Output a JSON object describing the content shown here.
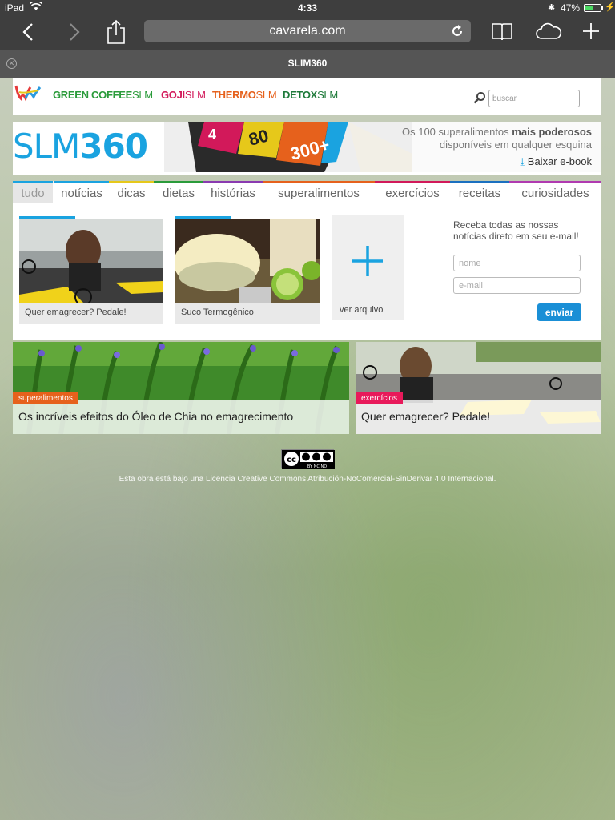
{
  "status": {
    "carrier": "iPad",
    "time": "4:33",
    "battery": "47%",
    "battery_level": 0.47
  },
  "browser": {
    "url": "cavarela.com",
    "tab_title": "SLIM360"
  },
  "brands": {
    "green_coffee_bold": "GREEN COFFEE",
    "green_coffee_thin": "SLM",
    "goji_bold": "GOJI",
    "goji_thin": "SLM",
    "thermo_bold": "THERMO",
    "thermo_thin": "SLM",
    "detox_bold": "DETOX",
    "detox_thin": "SLM"
  },
  "search": {
    "placeholder": "buscar"
  },
  "logo": {
    "light": "SLM",
    "bold": "360"
  },
  "banner": {
    "line1": "Os 100 superalimentos",
    "line1_bold": "mais poderosos",
    "line2": "disponíveis em qualquer esquina",
    "link": "Baixar e-book",
    "badge_a": "80",
    "badge_b": "300+",
    "badge_c": "4"
  },
  "nav": {
    "items": [
      {
        "label": "tudo",
        "color": "#1aa3e0"
      },
      {
        "label": "notícias",
        "color": "#1aa3e0"
      },
      {
        "label": "dicas",
        "color": "#e6c81a"
      },
      {
        "label": "dietas",
        "color": "#2a9b3a"
      },
      {
        "label": "histórias",
        "color": "#8a3ab0"
      },
      {
        "label": "superalimentos",
        "color": "#e6611c"
      },
      {
        "label": "exercícios",
        "color": "#d2195a"
      },
      {
        "label": "receitas",
        "color": "#1a70c0"
      },
      {
        "label": "curiosidades",
        "color": "#b03ab0"
      }
    ]
  },
  "cards": [
    {
      "caption": "Quer emagrecer? Pedale!"
    },
    {
      "caption": "Suco Termogênico"
    }
  ],
  "archive": {
    "caption": "ver arquivo"
  },
  "newsletter": {
    "title": "Receba todas as nossas notícias direto em seu e-mail!",
    "name_placeholder": "nome",
    "email_placeholder": "e-mail",
    "send": "enviar"
  },
  "features": [
    {
      "tag": "superalimentos",
      "tag_color": "#e6611c",
      "headline": "Os incríveis efeitos do Óleo de Chia no emagrecimento"
    },
    {
      "tag": "exercícios",
      "tag_color": "#e8195a",
      "headline": "Quer emagrecer? Pedale!"
    }
  ],
  "footer": {
    "cc_labels": "BY NC ND",
    "license": "Esta obra está bajo una Licencia Creative Commons Atribución-NoComercial-SinDerivar 4.0 Internacional."
  }
}
